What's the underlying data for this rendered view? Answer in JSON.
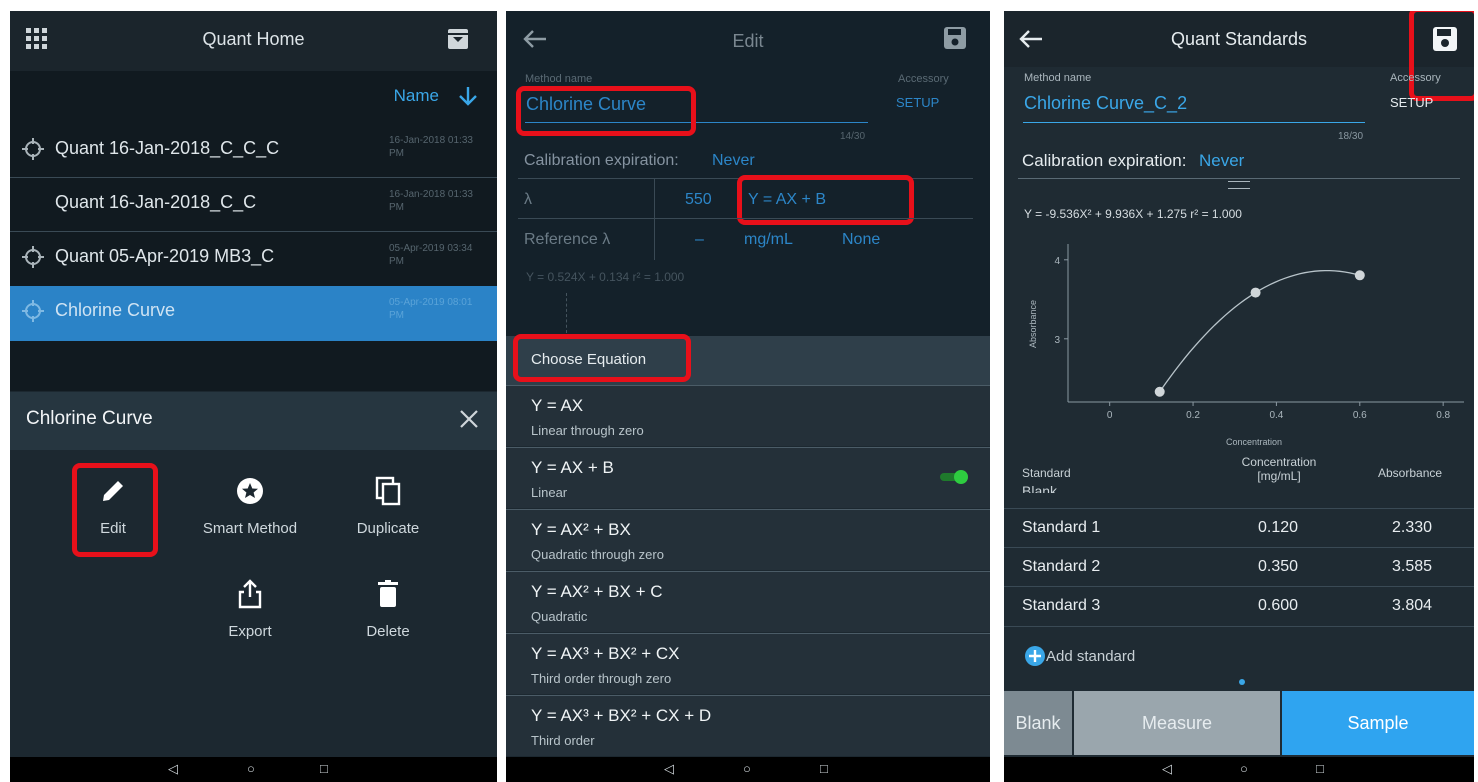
{
  "home": {
    "title": "Quant Home",
    "sort_label": "Name",
    "items": [
      {
        "name": "Quant 16-Jan-2018_C_C_C",
        "date": "16-Jan-2018 01:33 PM"
      },
      {
        "name": "Quant 16-Jan-2018_C_C",
        "date": "16-Jan-2018 01:33 PM"
      },
      {
        "name": "Quant 05-Apr-2019 MB3_C",
        "date": "05-Apr-2019 03:34 PM"
      },
      {
        "name": "Chlorine Curve",
        "date": "05-Apr-2019 08:01 PM"
      }
    ],
    "sheet_title": "Chlorine Curve",
    "actions": {
      "edit": "Edit",
      "smart": "Smart Method",
      "duplicate": "Duplicate",
      "export": "Export",
      "delete": "Delete"
    }
  },
  "edit": {
    "title": "Edit",
    "method_label": "Method name",
    "method_value": "Chlorine Curve",
    "char_count": "14/30",
    "accessory_label": "Accessory",
    "accessory_value": "SETUP",
    "cal_label": "Calibration expiration:",
    "cal_value": "Never",
    "lambda_label": "λ",
    "lambda_value": "550",
    "equation_value": "Y = AX + B",
    "ref_label": "Reference λ",
    "ref_value": "–",
    "unit_value": "mg/mL",
    "ref_mode": "None",
    "fit_text": "Y = 0.524X + 0.134   r² = 1.000",
    "choose_label": "Choose Equation",
    "equations": [
      {
        "eq": "Y = AX",
        "desc": "Linear through zero"
      },
      {
        "eq": "Y = AX + B",
        "desc": "Linear"
      },
      {
        "eq": "Y = AX² + BX",
        "desc": "Quadratic through zero"
      },
      {
        "eq": "Y = AX² + BX + C",
        "desc": "Quadratic"
      },
      {
        "eq": "Y = AX³ + BX² + CX",
        "desc": "Third order through zero"
      },
      {
        "eq": "Y = AX³ + BX² + CX + D",
        "desc": "Third order"
      }
    ],
    "selected_index": 1
  },
  "standards": {
    "title": "Quant Standards",
    "method_label": "Method name",
    "method_value": "Chlorine Curve_C_2",
    "char_count": "18/30",
    "accessory_label": "Accessory",
    "accessory_value": "SETUP",
    "cal_label": "Calibration expiration:",
    "cal_value": "Never",
    "fit_text": "Y = -9.536X² + 9.936X + 1.275   r² = 1.000",
    "table_headers": [
      "Standard",
      "Concentration [mg/mL]",
      "Absorbance"
    ],
    "partial_row": "Blank",
    "rows": [
      {
        "standard": "Standard 1",
        "conc": "0.120",
        "abs": "2.330"
      },
      {
        "standard": "Standard 2",
        "conc": "0.350",
        "abs": "3.585"
      },
      {
        "standard": "Standard 3",
        "conc": "0.600",
        "abs": "3.804"
      }
    ],
    "add_label": "Add standard",
    "btn_blank": "Blank",
    "btn_measure": "Measure",
    "btn_sample": "Sample"
  },
  "colors": {
    "accent": "#3aa7e8",
    "highlight": "#e8101a",
    "toggle": "#2ecc40"
  },
  "chart_data": {
    "type": "scatter",
    "xlabel": "Concentration",
    "ylabel": "Absorbance",
    "x_ticks": [
      "0",
      "0.2",
      "0.4",
      "0.6",
      "0.8"
    ],
    "y_ticks": [
      "3",
      "4"
    ],
    "xlim": [
      -0.1,
      0.85
    ],
    "ylim": [
      2.2,
      4.2
    ],
    "points": [
      {
        "x": 0.12,
        "y": 2.33
      },
      {
        "x": 0.35,
        "y": 3.585
      },
      {
        "x": 0.6,
        "y": 3.804
      }
    ],
    "fit": {
      "a": -9.536,
      "b": 9.936,
      "c": 1.275
    }
  }
}
